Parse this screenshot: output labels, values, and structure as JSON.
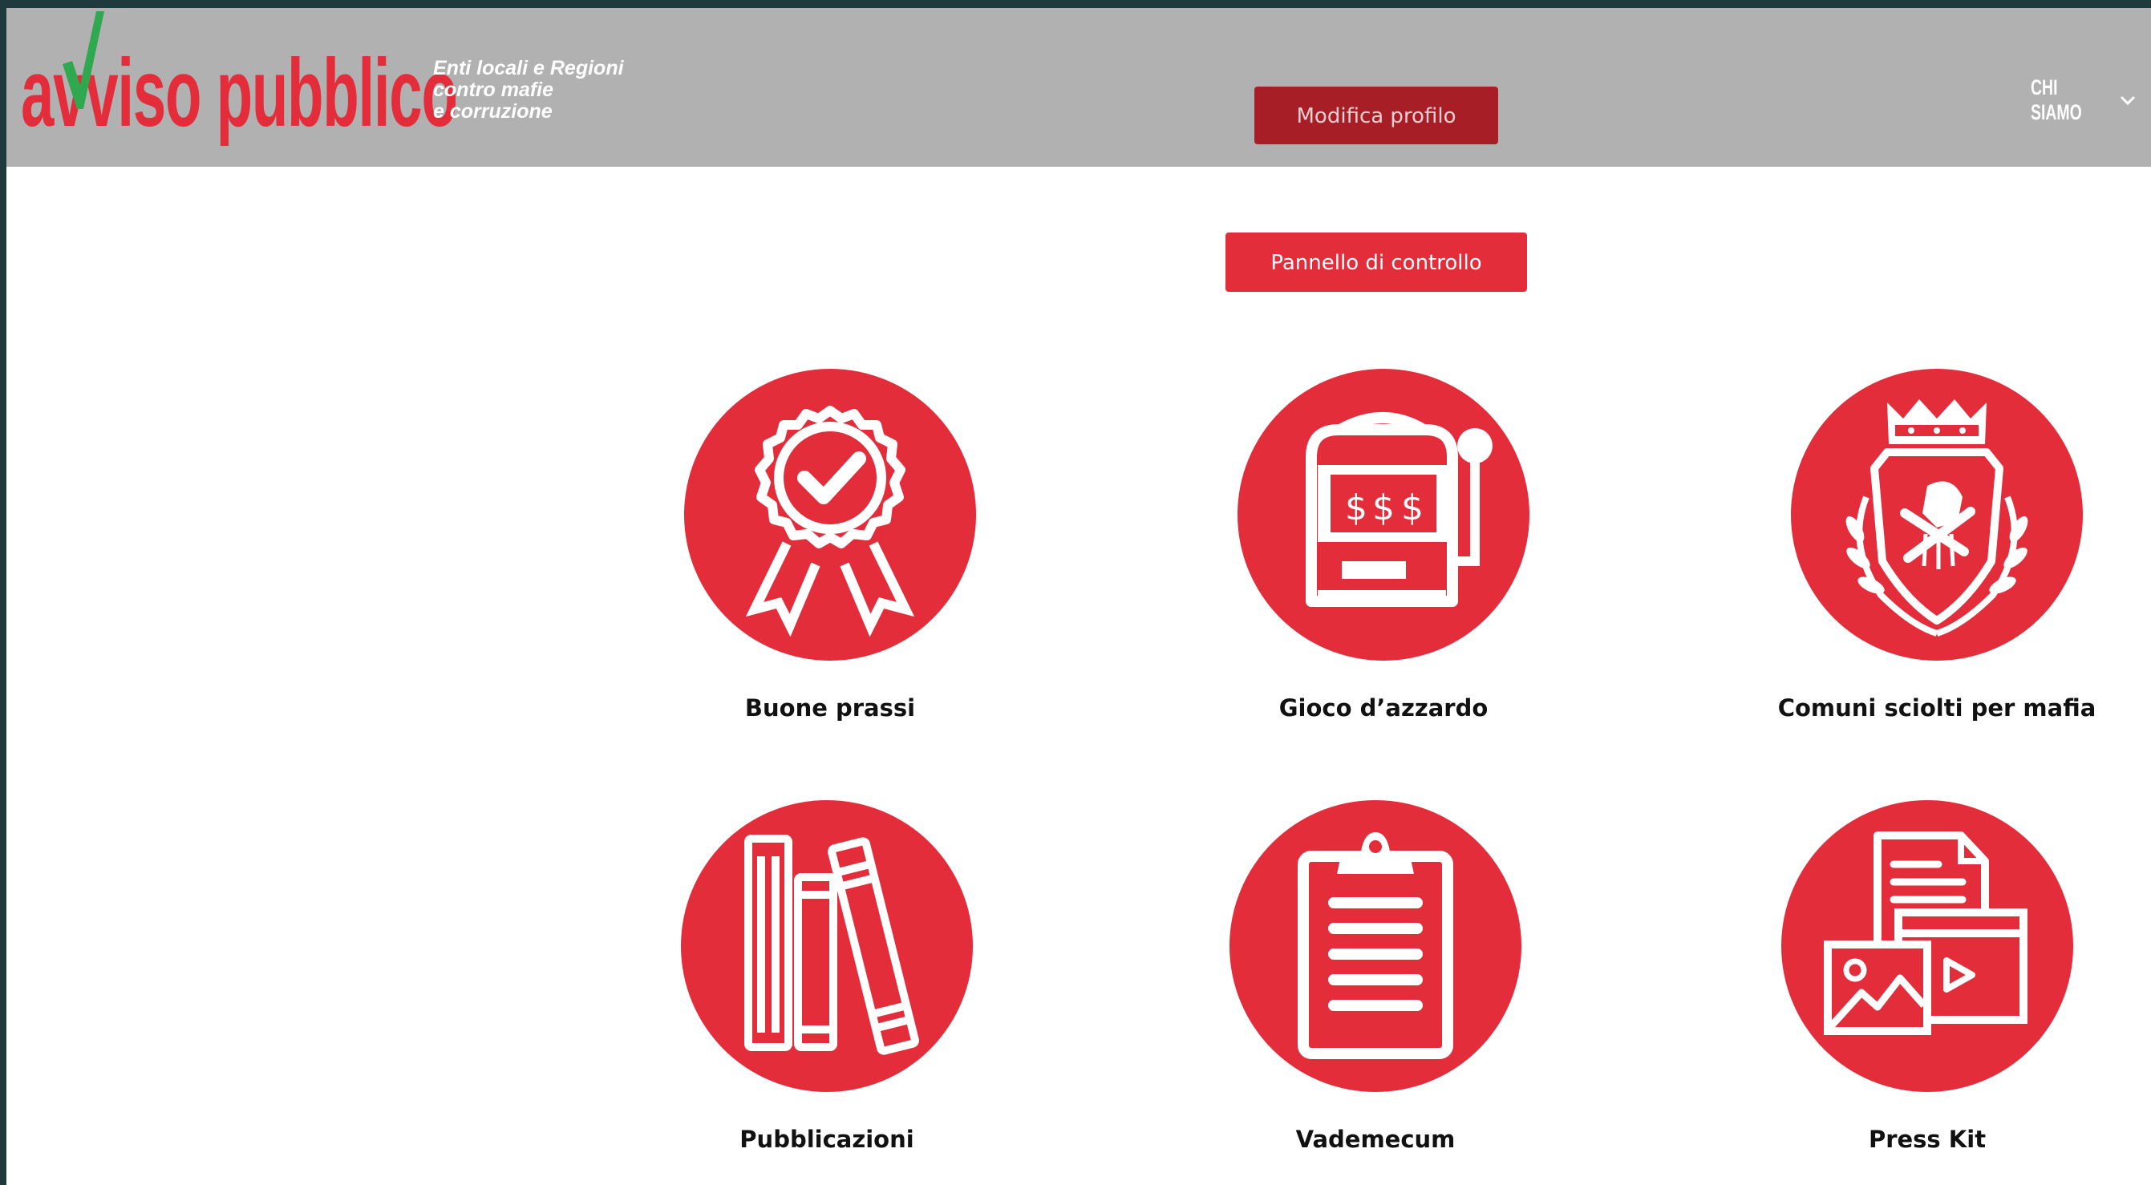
{
  "header": {
    "logo": {
      "text": "avviso pubblico",
      "tagline": [
        "Enti locali e Regioni",
        "contro mafie",
        "e corruzione"
      ]
    },
    "profile_button": "Modifica profilo",
    "nav": {
      "chi_siamo": "CHI SIAMO"
    }
  },
  "main": {
    "panel_button": "Pannello di controllo",
    "tiles": [
      {
        "label": "Buone prassi",
        "icon": "award-badge-icon"
      },
      {
        "label": "Gioco d’azzardo",
        "icon": "slot-machine-icon"
      },
      {
        "label": "Comuni sciolti per mafia",
        "icon": "city-crest-icon"
      },
      {
        "label": "Pubblicazioni",
        "icon": "books-icon"
      },
      {
        "label": "Vademecum",
        "icon": "clipboard-icon"
      },
      {
        "label": "Press Kit",
        "icon": "press-kit-media-icon"
      }
    ]
  },
  "colors": {
    "brand_red": "#e32d3b",
    "dark_red": "#a81e26",
    "header_gray": "#b1b1b1",
    "logo_tick_green": "#2fa84f"
  }
}
